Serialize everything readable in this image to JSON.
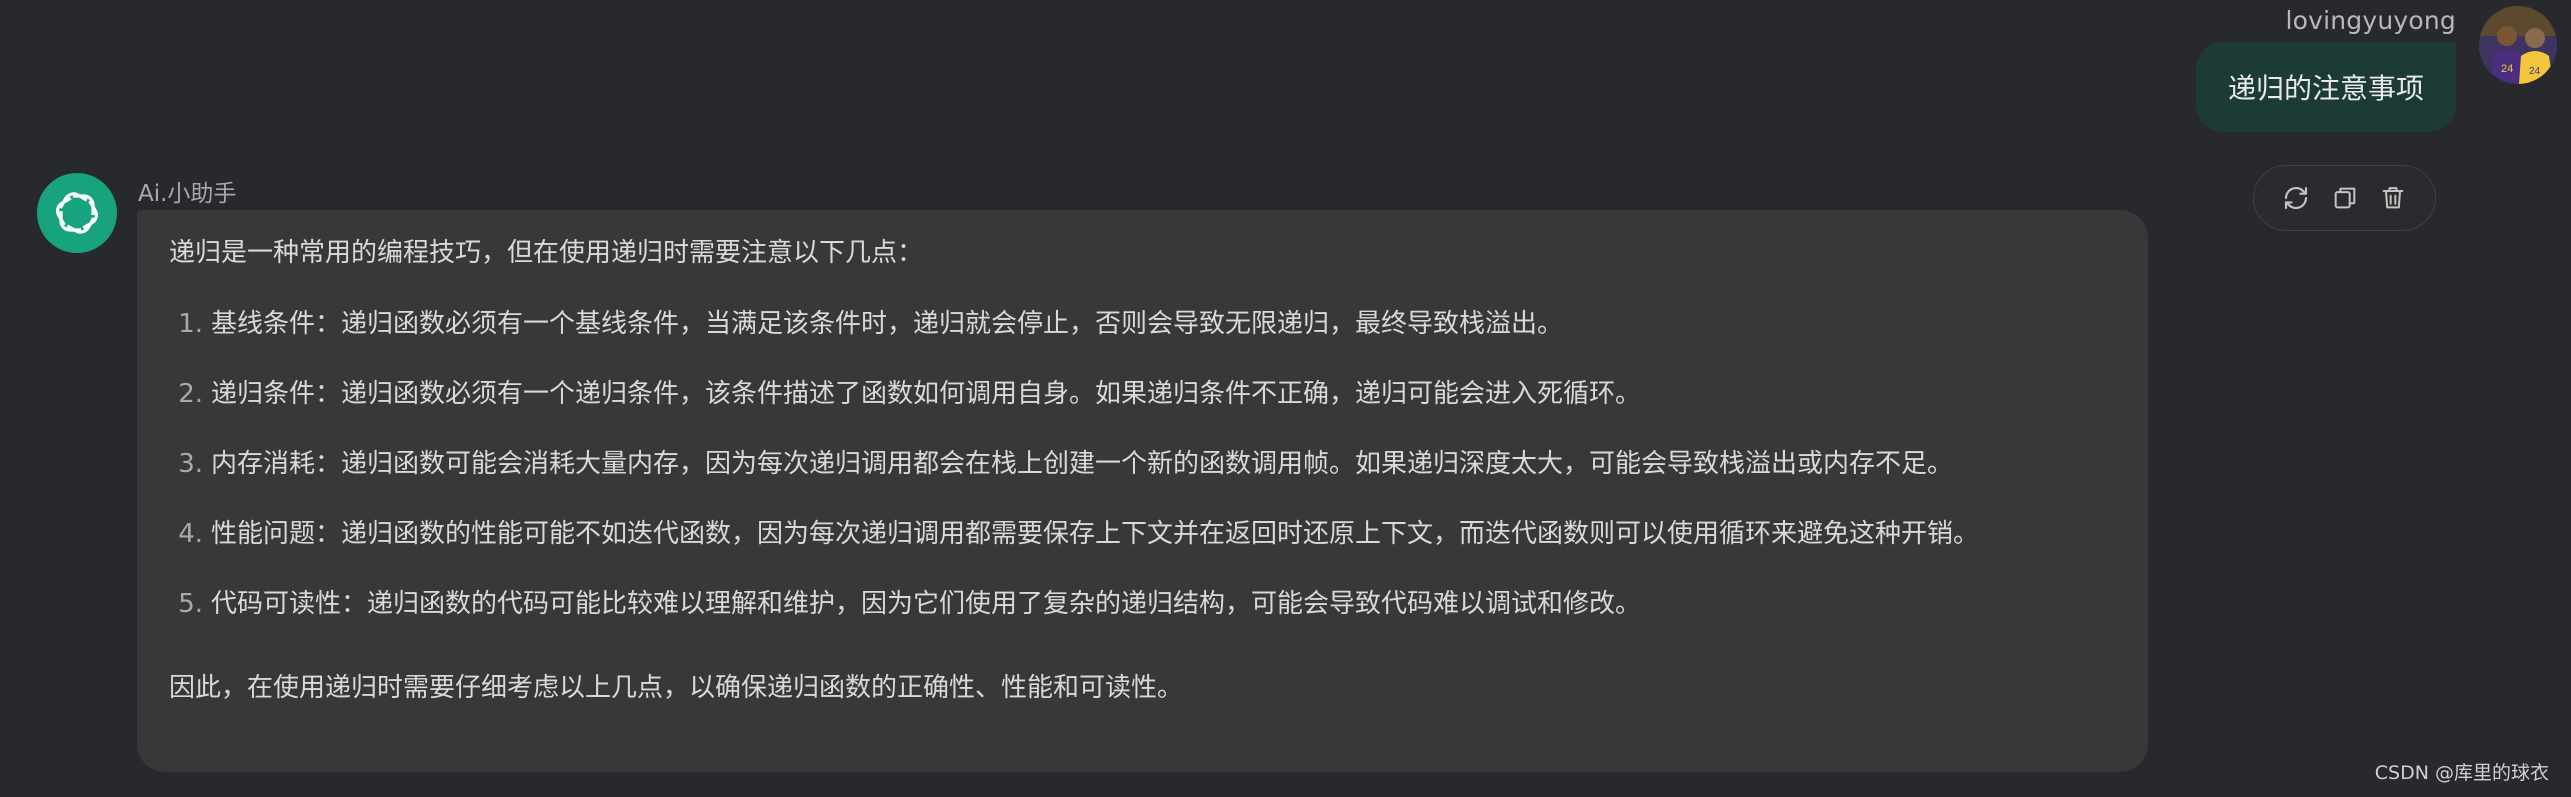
{
  "user": {
    "name": "lovingyuyong",
    "message": "递归的注意事项"
  },
  "actions": [
    "regenerate-icon",
    "copy-icon",
    "trash-icon"
  ],
  "assistant": {
    "name": "Ai.小助手",
    "intro": "递归是一种常用的编程技巧，但在使用递归时需要注意以下几点：",
    "points": [
      {
        "num": "1.",
        "text": "基线条件：递归函数必须有一个基线条件，当满足该条件时，递归就会停止，否则会导致无限递归，最终导致栈溢出。"
      },
      {
        "num": "2.",
        "text": "递归条件：递归函数必须有一个递归条件，该条件描述了函数如何调用自身。如果递归条件不正确，递归可能会进入死循环。"
      },
      {
        "num": "3.",
        "text": "内存消耗：递归函数可能会消耗大量内存，因为每次递归调用都会在栈上创建一个新的函数调用帧。如果递归深度太大，可能会导致栈溢出或内存不足。"
      },
      {
        "num": "4.",
        "text": "性能问题：递归函数的性能可能不如迭代函数，因为每次递归调用都需要保存上下文并在返回时还原上下文，而迭代函数则可以使用循环来避免这种开销。"
      },
      {
        "num": "5.",
        "text": "代码可读性：递归函数的代码可能比较难以理解和维护，因为它们使用了复杂的递归结构，可能会导致代码难以调试和修改。"
      }
    ],
    "conclusion": "因此，在使用递归时需要仔细考虑以上几点，以确保递归函数的正确性、性能和可读性。"
  },
  "watermark": "CSDN @库里的球衣",
  "colors": {
    "background": "#28292c",
    "user_bubble": "#1d3b36",
    "ai_bubble": "#38383b",
    "ai_avatar": "#18a37f"
  }
}
